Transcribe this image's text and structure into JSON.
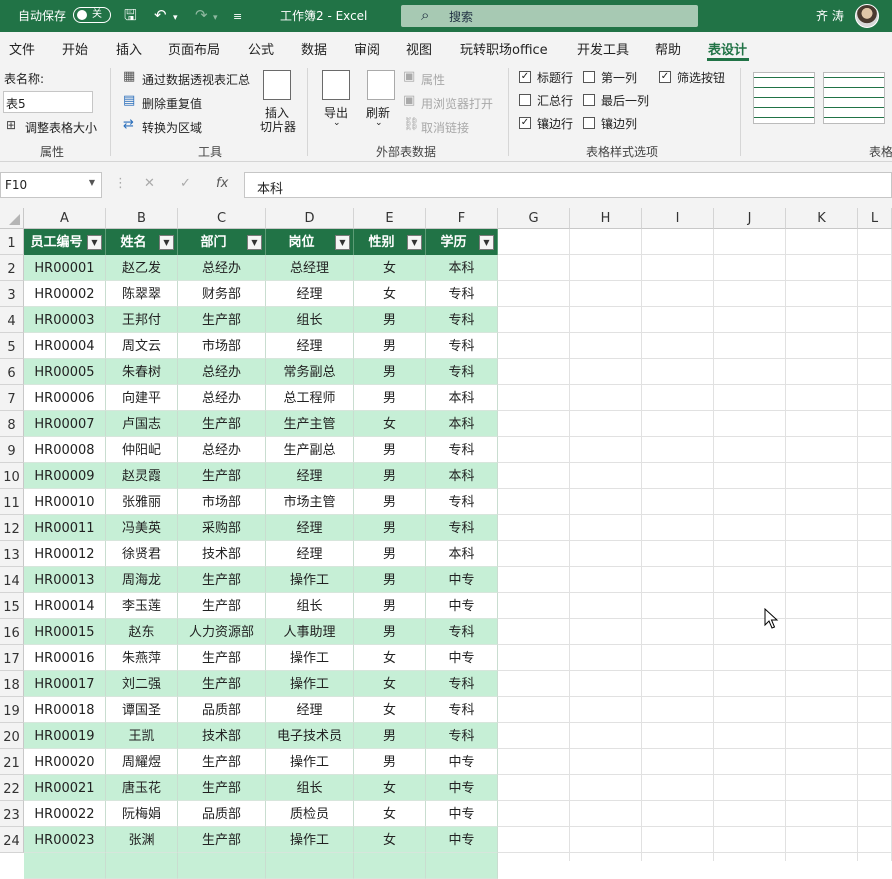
{
  "titlebar": {
    "autosave_label": "自动保存",
    "autosave_state": "关",
    "doc_title": "工作簿2  -  Excel",
    "search_placeholder": "搜索",
    "user_name": "齐 涛"
  },
  "menu": {
    "tabs": [
      "文件",
      "开始",
      "插入",
      "页面布局",
      "公式",
      "数据",
      "审阅",
      "视图",
      "玩转职场office",
      "开发工具",
      "帮助",
      "表设计"
    ],
    "active": "表设计"
  },
  "ribbon": {
    "table_name_label": "表名称:",
    "table_name_value": "表5",
    "resize_table": "调整表格大小",
    "group_properties": "属性",
    "pivot_summary": "通过数据透视表汇总",
    "remove_duplicates": "删除重复值",
    "convert_range": "转换为区域",
    "insert_slicer": "插入",
    "insert_slicer_2": "切片器",
    "group_tools": "工具",
    "export": "导出",
    "refresh": "刷新",
    "properties_btn": "属性",
    "open_browser": "用浏览器打开",
    "unlink": "取消链接",
    "group_external": "外部表数据",
    "opt_header_row": "标题行",
    "opt_total_row": "汇总行",
    "opt_banded_rows": "镶边行",
    "opt_first_col": "第一列",
    "opt_last_col": "最后一列",
    "opt_banded_cols": "镶边列",
    "opt_filter_btn": "筛选按钮",
    "checked": {
      "header_row": true,
      "total_row": false,
      "banded_rows": true,
      "first_col": false,
      "last_col": false,
      "banded_cols": false,
      "filter_btn": true
    },
    "group_style_opts": "表格样式选项",
    "group_styles": "表格"
  },
  "formula_bar": {
    "name_box": "F10",
    "formula": "本科"
  },
  "columns": [
    "A",
    "B",
    "C",
    "D",
    "E",
    "F",
    "G",
    "H",
    "I",
    "J",
    "K",
    "L"
  ],
  "table": {
    "headers": [
      "员工编号",
      "姓名",
      "部门",
      "岗位",
      "性别",
      "学历"
    ],
    "rows": [
      [
        "HR00001",
        "赵乙发",
        "总经办",
        "总经理",
        "女",
        "本科"
      ],
      [
        "HR00002",
        "陈翠翠",
        "财务部",
        "经理",
        "女",
        "专科"
      ],
      [
        "HR00003",
        "王邦付",
        "生产部",
        "组长",
        "男",
        "专科"
      ],
      [
        "HR00004",
        "周文云",
        "市场部",
        "经理",
        "男",
        "专科"
      ],
      [
        "HR00005",
        "朱春树",
        "总经办",
        "常务副总",
        "男",
        "专科"
      ],
      [
        "HR00006",
        "向建平",
        "总经办",
        "总工程师",
        "男",
        "本科"
      ],
      [
        "HR00007",
        "卢国志",
        "生产部",
        "生产主管",
        "女",
        "本科"
      ],
      [
        "HR00008",
        "仲阳屺",
        "总经办",
        "生产副总",
        "男",
        "专科"
      ],
      [
        "HR00009",
        "赵灵霞",
        "生产部",
        "经理",
        "男",
        "本科"
      ],
      [
        "HR00010",
        "张雅丽",
        "市场部",
        "市场主管",
        "男",
        "专科"
      ],
      [
        "HR00011",
        "冯美英",
        "采购部",
        "经理",
        "男",
        "专科"
      ],
      [
        "HR00012",
        "徐贤君",
        "技术部",
        "经理",
        "男",
        "本科"
      ],
      [
        "HR00013",
        "周海龙",
        "生产部",
        "操作工",
        "男",
        "中专"
      ],
      [
        "HR00014",
        "李玉莲",
        "生产部",
        "组长",
        "男",
        "中专"
      ],
      [
        "HR00015",
        "赵东",
        "人力资源部",
        "人事助理",
        "男",
        "专科"
      ],
      [
        "HR00016",
        "朱燕萍",
        "生产部",
        "操作工",
        "女",
        "中专"
      ],
      [
        "HR00017",
        "刘二强",
        "生产部",
        "操作工",
        "女",
        "专科"
      ],
      [
        "HR00018",
        "谭国圣",
        "品质部",
        "经理",
        "女",
        "专科"
      ],
      [
        "HR00019",
        "王凯",
        "技术部",
        "电子技术员",
        "男",
        "专科"
      ],
      [
        "HR00020",
        "周耀煜",
        "生产部",
        "操作工",
        "男",
        "中专"
      ],
      [
        "HR00021",
        "唐玉花",
        "生产部",
        "组长",
        "女",
        "中专"
      ],
      [
        "HR00022",
        "阮梅娟",
        "品质部",
        "质检员",
        "女",
        "中专"
      ],
      [
        "HR00023",
        "张渊",
        "生产部",
        "操作工",
        "女",
        "中专"
      ]
    ]
  },
  "row_numbers": [
    "1",
    "2",
    "3",
    "4",
    "5",
    "6",
    "7",
    "8",
    "9",
    "10",
    "11",
    "12",
    "13",
    "14",
    "15",
    "16",
    "17",
    "18",
    "19",
    "20",
    "21",
    "22",
    "23",
    "24"
  ],
  "colors": {
    "accent": "#217346",
    "band": "#c6efd6",
    "row_alt": "#ffffff"
  }
}
